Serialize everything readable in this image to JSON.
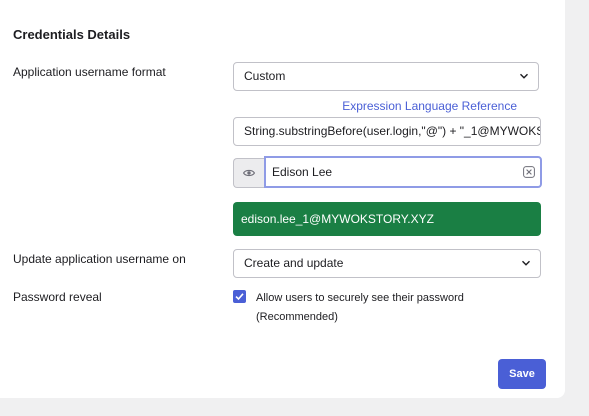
{
  "section": {
    "title": "Credentials Details"
  },
  "username_format": {
    "label": "Application username format",
    "selected": "Custom",
    "link": "Expression Language Reference",
    "expression": "String.substringBefore(user.login,\"@\") + \"_1@MYWOKS",
    "preview_user": "Edison Lee",
    "preview_result": "edison.lee_1@MYWOKSTORY.XYZ"
  },
  "update_on": {
    "label": "Update application username on",
    "selected": "Create and update"
  },
  "password_reveal": {
    "label": "Password reveal",
    "checked": true,
    "checkbox_label": "Allow users to securely see their password (Recommended)"
  },
  "actions": {
    "save_label": "Save"
  },
  "colors": {
    "accent": "#4a5fd6",
    "success": "#1a7f44",
    "focus_border": "#8f9be6"
  }
}
